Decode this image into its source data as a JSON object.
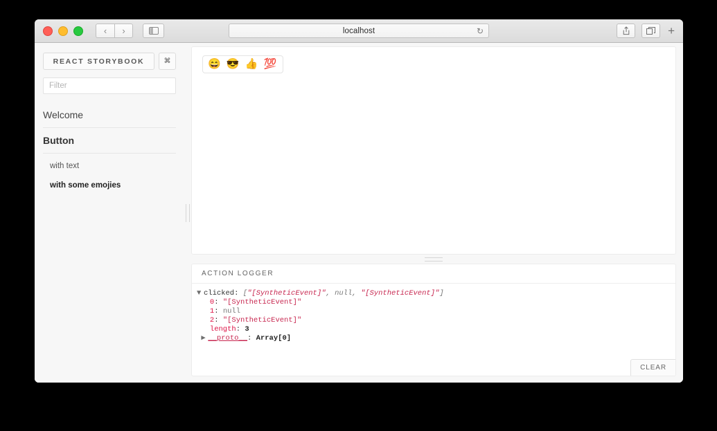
{
  "browser": {
    "url_text": "localhost",
    "reload_glyph": "↻",
    "back_glyph": "‹",
    "forward_glyph": "›",
    "sidebar_glyph": "▣",
    "share_glyph": "⇧",
    "tabs_glyph": "⧉",
    "plus_glyph": "+",
    "traffic": [
      "close",
      "minimize",
      "zoom"
    ]
  },
  "sidebar": {
    "brand": "REACT STORYBOOK",
    "shortcut_glyph": "⌘",
    "filter_placeholder": "Filter",
    "filter_value": "",
    "kinds": [
      {
        "title": "Welcome",
        "selected": false,
        "stories": []
      },
      {
        "title": "Button",
        "selected": true,
        "stories": [
          {
            "label": "with text",
            "selected": false
          },
          {
            "label": "with some emojies",
            "selected": true
          }
        ]
      }
    ]
  },
  "preview": {
    "button_label": "😄 😎 👍 💯"
  },
  "logger": {
    "title": "ACTION LOGGER",
    "clear_label": "CLEAR",
    "entries": [
      {
        "toggle": "▼",
        "name": "clicked",
        "preview_open": "[",
        "v0": "\"[SyntheticEvent]\"",
        "sep1": ", ",
        "v1": "null",
        "sep2": ", ",
        "v2": "\"[SyntheticEvent]\"",
        "preview_close": "]"
      }
    ],
    "rows": [
      {
        "key": "0",
        "value": "\"[SyntheticEvent]\"",
        "kind": "string"
      },
      {
        "key": "1",
        "value": "null",
        "kind": "null"
      },
      {
        "key": "2",
        "value": "\"[SyntheticEvent]\"",
        "kind": "string"
      },
      {
        "key": "length",
        "value": "3",
        "kind": "number"
      }
    ],
    "proto_row": {
      "toggle": "▶",
      "key": "__proto__",
      "value": "Array[0]"
    }
  },
  "colors": {
    "string_red": "#c7254e",
    "null_grey": "#777777",
    "key_pink": "#d14",
    "window_bg": "#f7f7f7",
    "panel_bg": "#ffffff"
  }
}
